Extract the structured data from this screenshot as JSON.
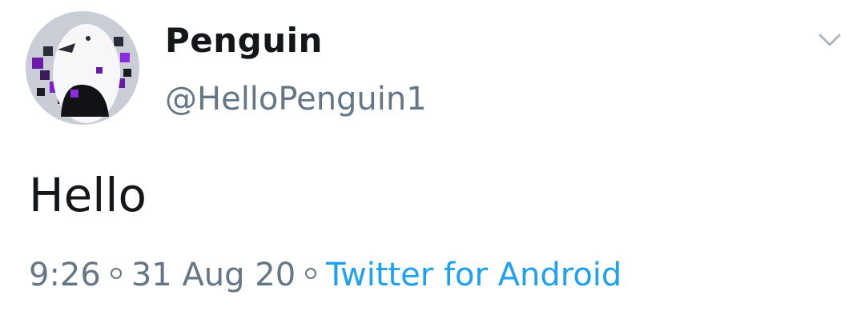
{
  "tweet": {
    "author": {
      "display_name": "Penguin",
      "handle": "@HelloPenguin1",
      "avatar_icon": "penguin-avatar"
    },
    "text": "Hello",
    "meta": {
      "time": "9:26",
      "date": "31 Aug 20",
      "source": "Twitter for Android"
    },
    "menu_icon": "chevron-down-icon"
  },
  "colors": {
    "text_primary": "#14171a",
    "text_secondary": "#657786",
    "link": "#1da1f2"
  }
}
